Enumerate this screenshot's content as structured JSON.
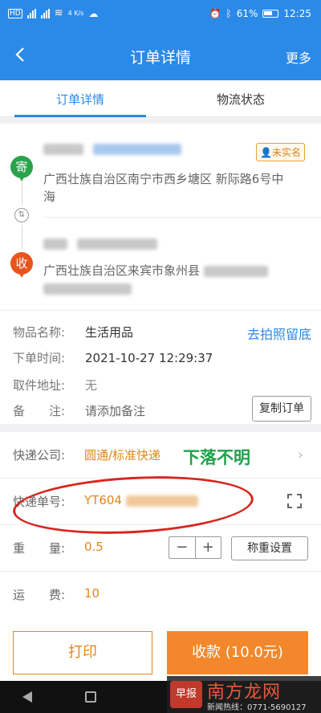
{
  "status_bar": {
    "left_indicators": [
      "HD",
      "4G",
      "4G",
      "4 K/s"
    ],
    "battery": "61%",
    "time": "12:25"
  },
  "nav": {
    "back_icon": "chevron-left-icon",
    "title": "订单详情",
    "more": "更多"
  },
  "tabs": [
    {
      "label": "订单详情",
      "active": true
    },
    {
      "label": "物流状态",
      "active": false
    }
  ],
  "sender": {
    "badge": "寄",
    "address": "广西壮族自治区南宁市西乡塘区 新际路6号中海",
    "unnamed_tag": "未实名"
  },
  "receiver": {
    "badge": "收",
    "address": "广西壮族自治区来宾市象州县"
  },
  "order_info": {
    "item_label": "物品名称:",
    "item_value": "生活用品",
    "photo_link": "去拍照留底",
    "time_label": "下单时间:",
    "time_value": "2021-10-27 12:29:37",
    "pickup_label": "取件地址:",
    "pickup_value": "无",
    "note_label": "备　　注:",
    "note_value": "请添加备注",
    "copy_button": "复制订单"
  },
  "shipping": {
    "company_label": "快递公司:",
    "company_value": "圆通/标准快递",
    "annotation": "下落不明",
    "tracking_label": "快递单号:",
    "tracking_value": "YT604",
    "weight_label": "重　　量:",
    "weight_value": "0.5",
    "minus": "−",
    "plus": "+",
    "reset_button": "称重设置",
    "fee_label": "运　　费:",
    "fee_value": "10"
  },
  "bottom": {
    "print_button": "打印",
    "pay_button": "收款 (10.0元)"
  },
  "watermark": {
    "logo": "早报",
    "text": "南方龙网",
    "sub": "新闻热线：0771-5690127"
  },
  "colors": {
    "primary": "#2b8ae8",
    "accent_orange": "#f2882b",
    "annotation_green": "#1ea34a",
    "circle_red": "#d8261e"
  }
}
